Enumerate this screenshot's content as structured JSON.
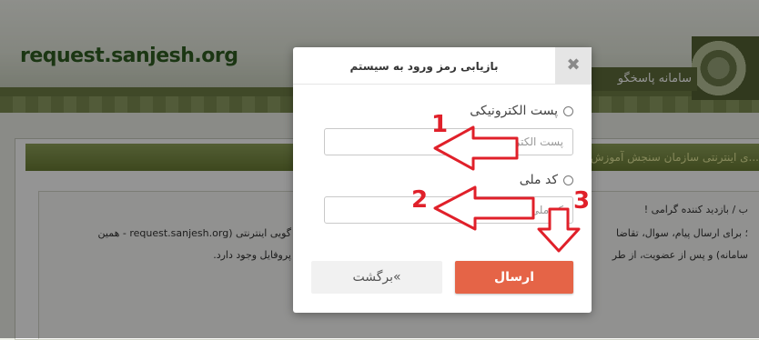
{
  "background_page": {
    "site_url": "request.sanjesh.org",
    "system_title": "سامانه پاسخگو",
    "panel_header": "...ی اینترنتی سازمان سنجش آموزش",
    "greeting": "ب / بازدید کننده گرامی !",
    "line1": "؛ برای ارسال پیام، سوال، تقاضا",
    "line2": "گویی اینترنتی (request.sanjesh.org - همین",
    "line3": "سامانه) و پس از عضویت، از طر",
    "line4": "پروفایل وجود دارد."
  },
  "modal": {
    "title": "بازیابی رمز ورود به سیستم",
    "close_label": "✖",
    "options": {
      "email_label": "پست الکترونیکی",
      "national_code_label": "کد ملی"
    },
    "fields": {
      "email_placeholder": "پست الکترونیکی",
      "national_code_placeholder": "کد ملی"
    },
    "buttons": {
      "back_label": "»برگشت",
      "send_label": "ارسال"
    }
  },
  "annotations": {
    "step1": "1",
    "step2": "2",
    "step3": "3",
    "color": "#e0202a"
  }
}
